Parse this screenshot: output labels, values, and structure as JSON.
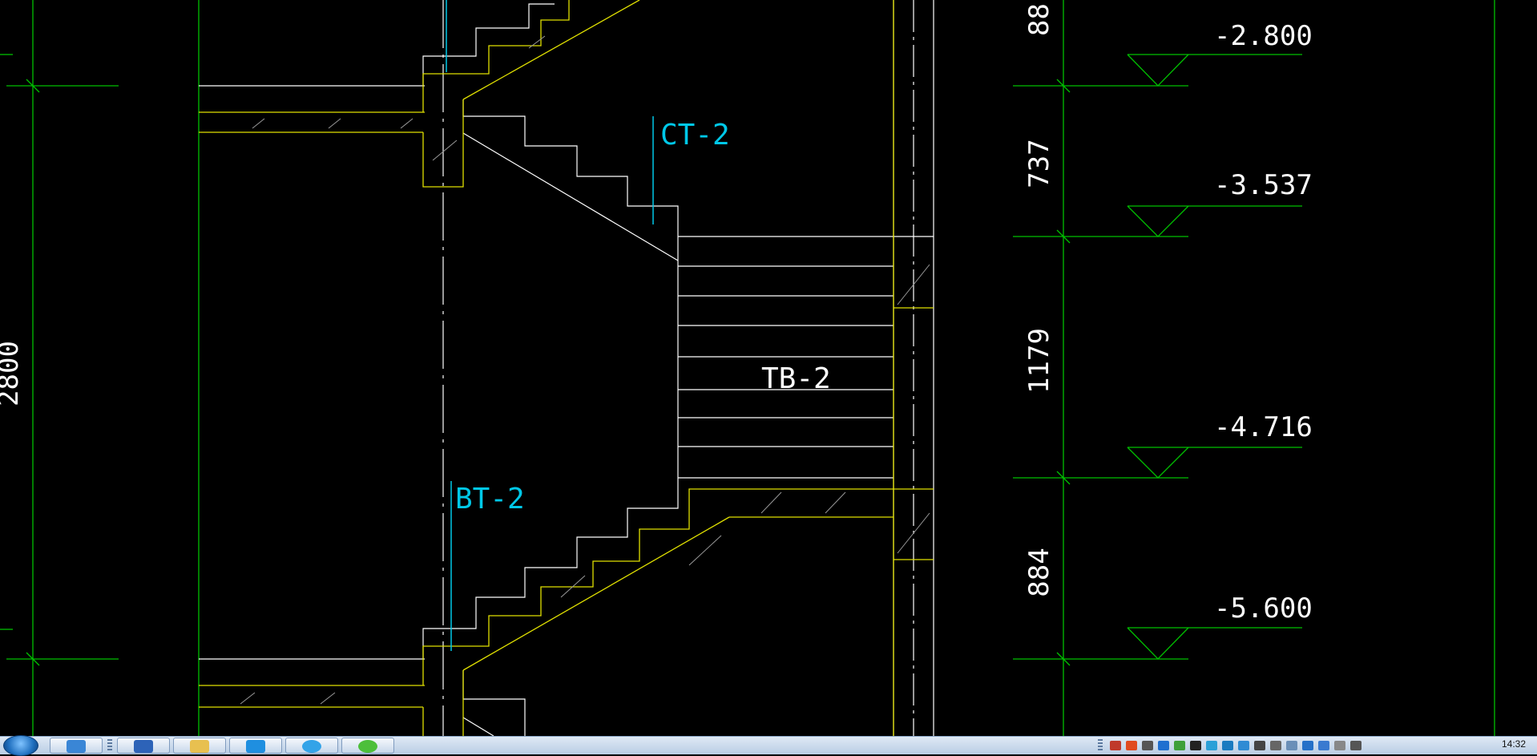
{
  "drawing": {
    "elevations": [
      "-2.800",
      "-3.537",
      "-4.716",
      "-5.600"
    ],
    "dimensions": [
      "737",
      "1179",
      "884",
      "2800",
      "88"
    ],
    "labels": {
      "ct": "CT-2",
      "bt": "BT-2",
      "tb": "TB-2"
    },
    "colors": {
      "grid": "#00c000",
      "label": "#00c8e8",
      "outline": "#e0e000",
      "white": "#ffffff",
      "background": "#000000"
    }
  },
  "taskbar": {
    "clock": "14:32",
    "apps": [
      {
        "name": "browser-icon",
        "color": "#3a86d6"
      },
      {
        "name": "cad-app-icon",
        "color": "#2d63b8"
      },
      {
        "name": "folder-icon",
        "color": "#e8c050"
      },
      {
        "name": "text-app-icon",
        "color": "#1f8fe0"
      },
      {
        "name": "qq-browser-icon",
        "color": "#33a3e8"
      },
      {
        "name": "wechat-icon",
        "color": "#4cbf3a"
      }
    ]
  }
}
